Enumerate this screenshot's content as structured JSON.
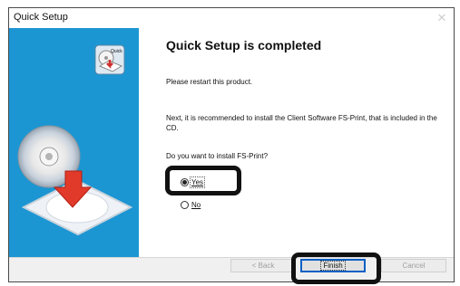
{
  "window": {
    "title": "Quick Setup",
    "close_glyph": "✕"
  },
  "badge_icon": {
    "name": "quick-setup-badge-icon",
    "label": "Quick"
  },
  "main": {
    "heading": "Quick Setup is completed",
    "restart_text": "Please restart this product.",
    "next_text": "Next, it is recommended to install the Client Software FS-Print, that is included in the CD.",
    "question": "Do you want to install FS-Print?",
    "options": {
      "yes": {
        "label": "Yes",
        "selected": true
      },
      "no": {
        "label": "No",
        "selected": false
      }
    }
  },
  "buttons": {
    "back": "< Back",
    "finish": "Finish",
    "cancel": "Cancel"
  },
  "colors": {
    "side_panel": "#1c96d2",
    "highlight": "#111111",
    "default_button_border": "#0a5fc4"
  }
}
